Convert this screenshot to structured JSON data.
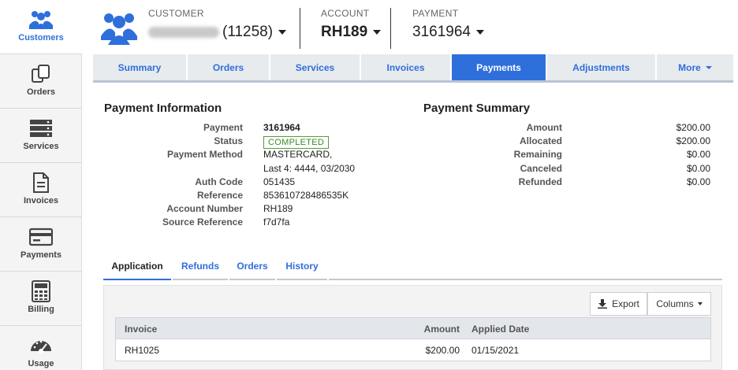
{
  "sidebar": {
    "items": [
      {
        "label": "Customers",
        "icon": "customers-icon",
        "active": true
      },
      {
        "label": "Orders",
        "icon": "orders-icon"
      },
      {
        "label": "Services",
        "icon": "services-icon"
      },
      {
        "label": "Invoices",
        "icon": "invoices-icon"
      },
      {
        "label": "Payments",
        "icon": "payments-icon"
      },
      {
        "label": "Billing",
        "icon": "billing-icon"
      },
      {
        "label": "Usage",
        "icon": "usage-icon"
      }
    ]
  },
  "header": {
    "customer_label": "CUSTOMER",
    "customer_id": "(11258)",
    "account_label": "ACCOUNT",
    "account_value": "RH189",
    "payment_label": "PAYMENT",
    "payment_value": "3161964"
  },
  "tabs": [
    {
      "label": "Summary"
    },
    {
      "label": "Orders"
    },
    {
      "label": "Services"
    },
    {
      "label": "Invoices"
    },
    {
      "label": "Payments",
      "active": true
    },
    {
      "label": "Adjustments"
    },
    {
      "label": "More"
    }
  ],
  "payment_info": {
    "title": "Payment Information",
    "fields": [
      {
        "key": "Payment",
        "value": "3161964"
      },
      {
        "key": "Status",
        "value": "COMPLETED"
      },
      {
        "key": "Payment Method",
        "value": "MASTERCARD,"
      },
      {
        "key": "",
        "value": "Last 4: 4444, 03/2030"
      },
      {
        "key": "Auth Code",
        "value": "051435"
      },
      {
        "key": "Reference",
        "value": "853610728486535K"
      },
      {
        "key": "Account Number",
        "value": "RH189"
      },
      {
        "key": "Source Reference",
        "value": "f7d7fa"
      }
    ]
  },
  "payment_summary": {
    "title": "Payment Summary",
    "fields": [
      {
        "key": "Amount",
        "value": "$200.00"
      },
      {
        "key": "Allocated",
        "value": "$200.00"
      },
      {
        "key": "Remaining",
        "value": "$0.00"
      },
      {
        "key": "Canceled",
        "value": "$0.00"
      },
      {
        "key": "Refunded",
        "value": "$0.00"
      }
    ]
  },
  "subtabs": [
    {
      "label": "Application",
      "active": true
    },
    {
      "label": "Refunds"
    },
    {
      "label": "Orders"
    },
    {
      "label": "History"
    }
  ],
  "toolbar": {
    "export_label": "Export",
    "columns_label": "Columns"
  },
  "table": {
    "columns": [
      "Invoice",
      "Amount",
      "Applied Date"
    ],
    "rows": [
      [
        "RH1025",
        "$200.00",
        "01/15/2021"
      ]
    ]
  },
  "colors": {
    "accent": "#2f6fdc",
    "status_green": "#3b8a26"
  }
}
